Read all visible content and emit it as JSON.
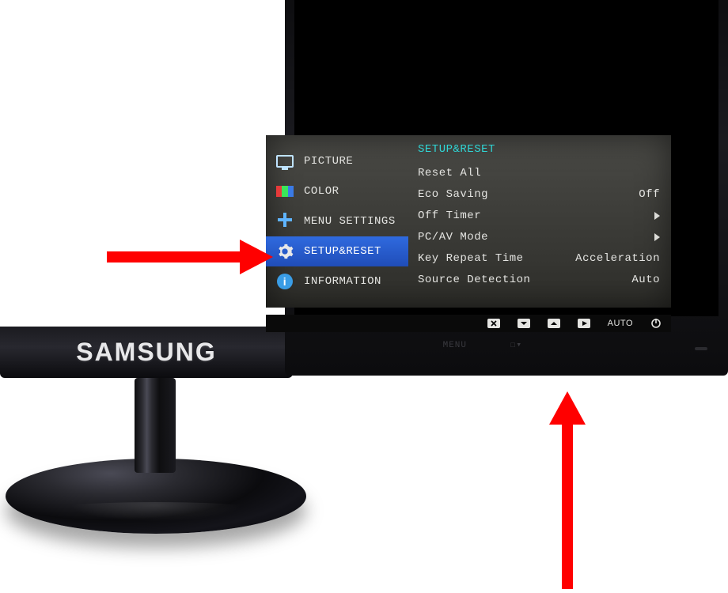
{
  "brand": "SAMSUNG",
  "bezel_buttons": {
    "menu": "MENU",
    "updown": "☐▾"
  },
  "osd": {
    "categories": [
      {
        "id": "picture",
        "label": "PICTURE"
      },
      {
        "id": "color",
        "label": "COLOR"
      },
      {
        "id": "menu-settings",
        "label": "MENU SETTINGS"
      },
      {
        "id": "setup-reset",
        "label": "SETUP&RESET",
        "selected": true
      },
      {
        "id": "information",
        "label": "INFORMATION"
      }
    ],
    "panel_header": "SETUP&RESET",
    "items": [
      {
        "id": "reset-all",
        "label": "Reset All",
        "value": ""
      },
      {
        "id": "eco-saving",
        "label": "Eco Saving",
        "value": "Off"
      },
      {
        "id": "off-timer",
        "label": "Off Timer",
        "value": "",
        "submenu": true
      },
      {
        "id": "pc-av-mode",
        "label": "PC/AV Mode",
        "value": "",
        "submenu": true
      },
      {
        "id": "key-repeat-time",
        "label": "Key Repeat Time",
        "value": "Acceleration"
      },
      {
        "id": "source-detection",
        "label": "Source Detection",
        "value": "Auto"
      }
    ]
  },
  "nav_strip": {
    "auto_label": "AUTO"
  },
  "annotations": {
    "arrow_to_menu_item": "points to SETUP&RESET category",
    "arrow_to_buttons": "points to physical bezel buttons"
  }
}
